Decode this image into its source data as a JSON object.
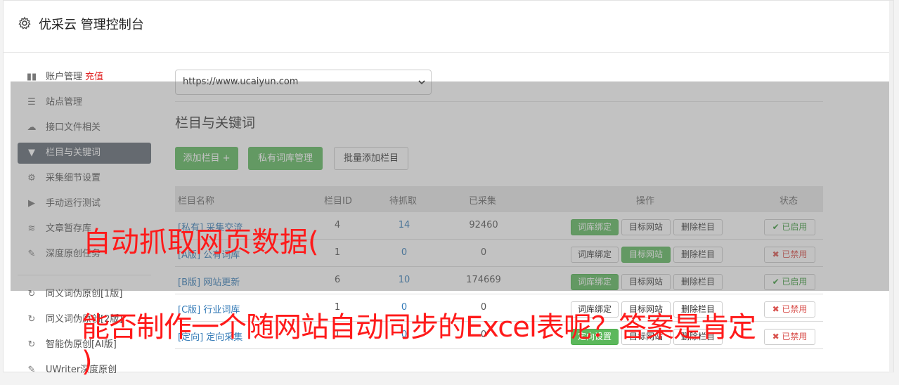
{
  "header": {
    "title": "优采云 管理控制台"
  },
  "sidebar": {
    "items": [
      {
        "icon": "bar-chart-icon",
        "label": "账户管理",
        "extra": "充值"
      },
      {
        "icon": "server-icon",
        "label": "站点管理"
      },
      {
        "icon": "cloud-upload-icon",
        "label": "接口文件相关"
      },
      {
        "icon": "filter-icon",
        "label": "栏目与关键词",
        "active": true
      },
      {
        "icon": "cogs-icon",
        "label": "采集细节设置"
      },
      {
        "icon": "play-circle-icon",
        "label": "手动运行测试"
      },
      {
        "icon": "database-icon",
        "label": "文章暂存库"
      },
      {
        "icon": "edit-icon",
        "label": "深度原创任务"
      }
    ],
    "items2": [
      {
        "icon": "refresh-icon",
        "label": "同义词伪原创[1版]"
      },
      {
        "icon": "refresh-icon",
        "label": "同义词伪原创[2版]"
      },
      {
        "icon": "refresh-icon",
        "label": "智能伪原创[AI版]"
      },
      {
        "icon": "edit-icon",
        "label": "UWriter深度原创"
      }
    ]
  },
  "main": {
    "site_select": "https://www.ucaiyun.com",
    "section_title": "栏目与关键词",
    "buttons": {
      "add_column": "添加栏目 +",
      "private_lib": "私有词库管理",
      "batch_add": "批量添加栏目"
    },
    "table": {
      "headers": [
        "栏目名称",
        "栏目ID",
        "待抓取",
        "已采集",
        "操作",
        "状态"
      ],
      "rows": [
        {
          "tag": "[私有]",
          "name": "采集交流",
          "id": "4",
          "wait": "14",
          "done": "92460",
          "op1": "词库绑定",
          "op1_green": true,
          "op2": "目标网站",
          "op2_green": false,
          "op3": "删除栏目",
          "status": "✔ 已启用",
          "on": true
        },
        {
          "tag": "[A版]",
          "name": "公有词库",
          "id": "1",
          "wait": "0",
          "done": "0",
          "op1": "词库绑定",
          "op1_green": false,
          "op2": "目标网站",
          "op2_green": true,
          "op3": "删除栏目",
          "status": "✖ 已禁用",
          "on": false
        },
        {
          "tag": "[B版]",
          "name": "网站更新",
          "id": "6",
          "wait": "10",
          "done": "174669",
          "op1": "词库绑定",
          "op1_green": true,
          "op2": "目标网站",
          "op2_green": false,
          "op3": "删除栏目",
          "status": "✔ 已启用",
          "on": true
        },
        {
          "tag": "[C版]",
          "name": "行业词库",
          "id": "1",
          "wait": "0",
          "done": "0",
          "op1": "词库绑定",
          "op1_green": false,
          "op2": "目标网站",
          "op2_green": false,
          "op3": "删除栏目",
          "status": "✖ 已禁用",
          "on": false
        },
        {
          "tag": "[定向]",
          "name": "定向采集",
          "id": "1",
          "wait": "0",
          "done": "0",
          "op1": "定向设置",
          "op1_green": true,
          "op2": "目标网站",
          "op2_green": false,
          "op3": "删除栏目",
          "status": "✖ 已禁用",
          "on": false
        }
      ]
    }
  },
  "captions": {
    "line1": "自动抓取网页数据(",
    "line2": "能否制作一个随网站自动同步的Excel表呢？答案是肯定",
    "line3": ")"
  },
  "colors": {
    "green": "#5cb85c",
    "active_sidebar": "#5f6873",
    "link": "#337ab7",
    "caption": "#ff1a1a"
  }
}
